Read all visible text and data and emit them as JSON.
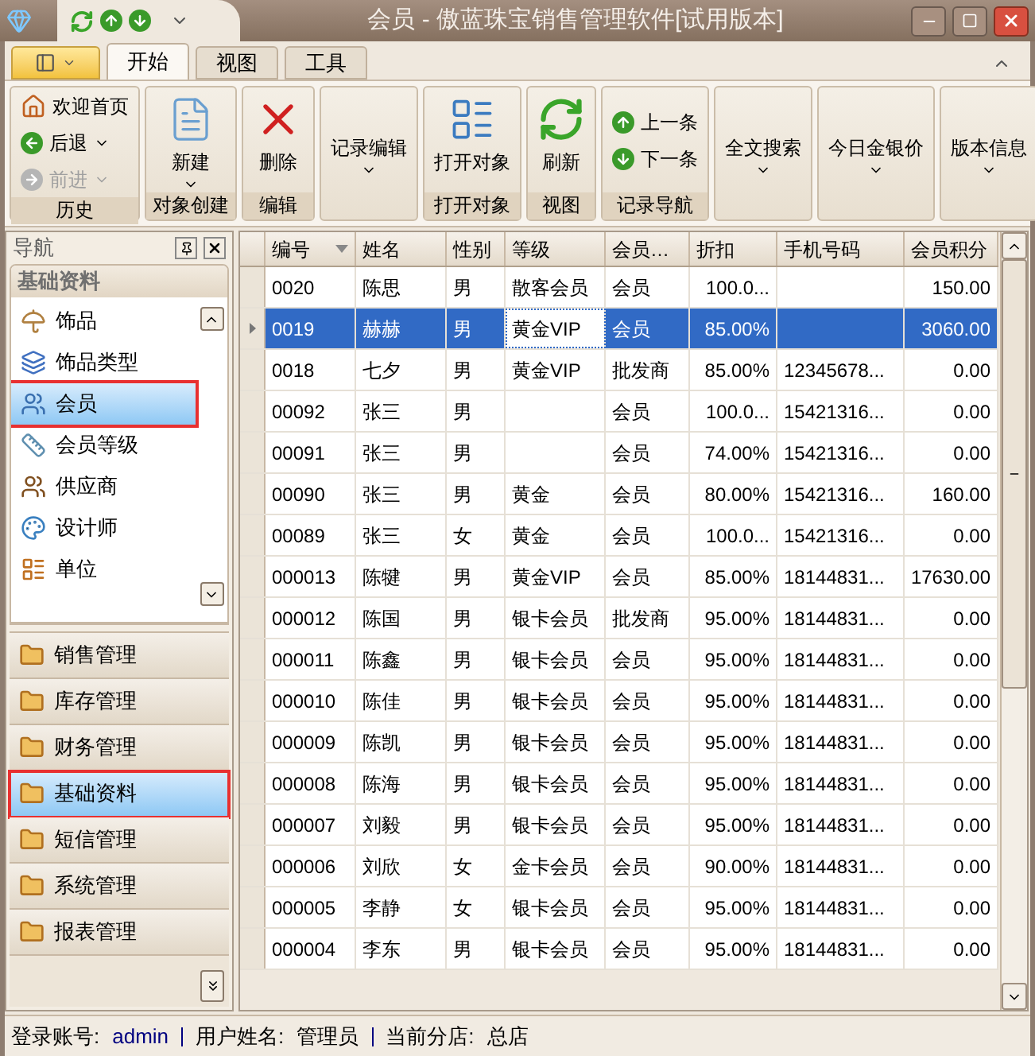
{
  "window": {
    "title": "会员 - 傲蓝珠宝销售管理软件[试用版本]"
  },
  "ribbon_tabs": [
    {
      "label": "开始",
      "selected": true
    },
    {
      "label": "视图",
      "selected": false
    },
    {
      "label": "工具",
      "selected": false
    }
  ],
  "ribbon_groups": [
    {
      "caption": "历史",
      "items": [
        {
          "label": "欢迎首页",
          "kind": "home",
          "disabled": false,
          "dropdown": false
        },
        {
          "label": "后退",
          "kind": "back",
          "disabled": false,
          "dropdown": true
        },
        {
          "label": "前进",
          "kind": "forward",
          "disabled": true,
          "dropdown": true
        }
      ]
    },
    {
      "caption": "对象创建",
      "items": [
        {
          "label": "新建",
          "kind": "new",
          "disabled": false,
          "dropdown": true
        }
      ]
    },
    {
      "caption": "编辑",
      "items": [
        {
          "label": "删除",
          "kind": "delete",
          "disabled": false,
          "dropdown": false
        }
      ]
    },
    {
      "items": [
        {
          "label": "记录编辑",
          "kind": "text",
          "disabled": false,
          "dropdown": true
        }
      ]
    },
    {
      "caption": "打开对象",
      "items": [
        {
          "label": "打开对象",
          "kind": "open",
          "disabled": false,
          "dropdown": false
        }
      ]
    },
    {
      "caption": "视图",
      "items": [
        {
          "label": "刷新",
          "kind": "refresh",
          "disabled": false,
          "dropdown": false
        }
      ]
    },
    {
      "caption": "记录导航",
      "items": [
        {
          "label": "上一条",
          "kind": "up",
          "disabled": false,
          "dropdown": false
        },
        {
          "label": "下一条",
          "kind": "down",
          "disabled": false,
          "dropdown": false
        }
      ]
    },
    {
      "items": [
        {
          "label": "全文搜索",
          "kind": "text",
          "disabled": false,
          "dropdown": true
        }
      ]
    },
    {
      "items": [
        {
          "label": "今日金银价",
          "kind": "text",
          "disabled": false,
          "dropdown": true
        }
      ]
    },
    {
      "items": [
        {
          "label": "版本信息",
          "kind": "text",
          "disabled": false,
          "dropdown": true
        }
      ]
    }
  ],
  "nav": {
    "title": "导航",
    "group_title": "基础资料",
    "items": [
      {
        "label": "饰品",
        "kind": "umbrella",
        "selected": false,
        "highlighted": false
      },
      {
        "label": "饰品类型",
        "kind": "stack",
        "selected": false,
        "highlighted": false
      },
      {
        "label": "会员",
        "kind": "users",
        "selected": true,
        "highlighted": true
      },
      {
        "label": "会员等级",
        "kind": "grade",
        "selected": false,
        "highlighted": false
      },
      {
        "label": "供应商",
        "kind": "people",
        "selected": false,
        "highlighted": false
      },
      {
        "label": "设计师",
        "kind": "designer",
        "selected": false,
        "highlighted": false
      },
      {
        "label": "单位",
        "kind": "unit",
        "selected": false,
        "highlighted": false
      }
    ],
    "groups": [
      {
        "label": "销售管理",
        "selected": false,
        "highlighted": false
      },
      {
        "label": "库存管理",
        "selected": false,
        "highlighted": false
      },
      {
        "label": "财务管理",
        "selected": false,
        "highlighted": false
      },
      {
        "label": "基础资料",
        "selected": true,
        "highlighted": true
      },
      {
        "label": "短信管理",
        "selected": false,
        "highlighted": false
      },
      {
        "label": "系统管理",
        "selected": false,
        "highlighted": false
      },
      {
        "label": "报表管理",
        "selected": false,
        "highlighted": false
      }
    ]
  },
  "table": {
    "columns": [
      {
        "label": "编号",
        "sorted": true,
        "kind": "text",
        "focused": false
      },
      {
        "label": "姓名",
        "sorted": false,
        "kind": "text",
        "focused": false
      },
      {
        "label": "性别",
        "sorted": false,
        "kind": "text",
        "focused": false
      },
      {
        "label": "等级",
        "sorted": false,
        "kind": "text",
        "focused": true
      },
      {
        "label": "会员…",
        "sorted": false,
        "kind": "text",
        "focused": false
      },
      {
        "label": "折扣",
        "sorted": false,
        "kind": "number",
        "focused": false
      },
      {
        "label": "手机号码",
        "sorted": false,
        "kind": "text",
        "focused": false
      },
      {
        "label": "会员积分",
        "sorted": false,
        "kind": "number",
        "focused": false
      }
    ],
    "rows": [
      {
        "selected": false,
        "cells": [
          "0020",
          "陈思",
          "男",
          "散客会员",
          "会员",
          "100.0...",
          "",
          "150.00"
        ]
      },
      {
        "selected": true,
        "cells": [
          "0019",
          "赫赫",
          "男",
          "黄金VIP",
          "会员",
          "85.00%",
          "",
          "3060.00"
        ]
      },
      {
        "selected": false,
        "cells": [
          "0018",
          "七夕",
          "男",
          "黄金VIP",
          "批发商",
          "85.00%",
          "12345678...",
          "0.00"
        ]
      },
      {
        "selected": false,
        "cells": [
          "00092",
          "张三",
          "男",
          "",
          "会员",
          "100.0...",
          "15421316...",
          "0.00"
        ]
      },
      {
        "selected": false,
        "cells": [
          "00091",
          "张三",
          "男",
          "",
          "会员",
          "74.00%",
          "15421316...",
          "0.00"
        ]
      },
      {
        "selected": false,
        "cells": [
          "00090",
          "张三",
          "男",
          "黄金",
          "会员",
          "80.00%",
          "15421316...",
          "160.00"
        ]
      },
      {
        "selected": false,
        "cells": [
          "00089",
          "张三",
          "女",
          "黄金",
          "会员",
          "100.0...",
          "15421316...",
          "0.00"
        ]
      },
      {
        "selected": false,
        "cells": [
          "000013",
          "陈犍",
          "男",
          "黄金VIP",
          "会员",
          "85.00%",
          "18144831...",
          "17630.00"
        ]
      },
      {
        "selected": false,
        "cells": [
          "000012",
          "陈国",
          "男",
          "银卡会员",
          "批发商",
          "95.00%",
          "18144831...",
          "0.00"
        ]
      },
      {
        "selected": false,
        "cells": [
          "000011",
          "陈鑫",
          "男",
          "银卡会员",
          "会员",
          "95.00%",
          "18144831...",
          "0.00"
        ]
      },
      {
        "selected": false,
        "cells": [
          "000010",
          "陈佳",
          "男",
          "银卡会员",
          "会员",
          "95.00%",
          "18144831...",
          "0.00"
        ]
      },
      {
        "selected": false,
        "cells": [
          "000009",
          "陈凯",
          "男",
          "银卡会员",
          "会员",
          "95.00%",
          "18144831...",
          "0.00"
        ]
      },
      {
        "selected": false,
        "cells": [
          "000008",
          "陈海",
          "男",
          "银卡会员",
          "会员",
          "95.00%",
          "18144831...",
          "0.00"
        ]
      },
      {
        "selected": false,
        "cells": [
          "000007",
          "刘毅",
          "男",
          "银卡会员",
          "会员",
          "95.00%",
          "18144831...",
          "0.00"
        ]
      },
      {
        "selected": false,
        "cells": [
          "000006",
          "刘欣",
          "女",
          "金卡会员",
          "会员",
          "90.00%",
          "18144831...",
          "0.00"
        ]
      },
      {
        "selected": false,
        "cells": [
          "000005",
          "李静",
          "女",
          "银卡会员",
          "会员",
          "95.00%",
          "18144831...",
          "0.00"
        ]
      },
      {
        "selected": false,
        "cells": [
          "000004",
          "李东",
          "男",
          "银卡会员",
          "会员",
          "95.00%",
          "18144831...",
          "0.00"
        ]
      }
    ]
  },
  "status_bar": [
    {
      "label": "登录账号:",
      "value": "admin"
    },
    {
      "label": "用户姓名:",
      "value": "管理员"
    },
    {
      "label": "当前分店:",
      "value": "总店"
    }
  ]
}
